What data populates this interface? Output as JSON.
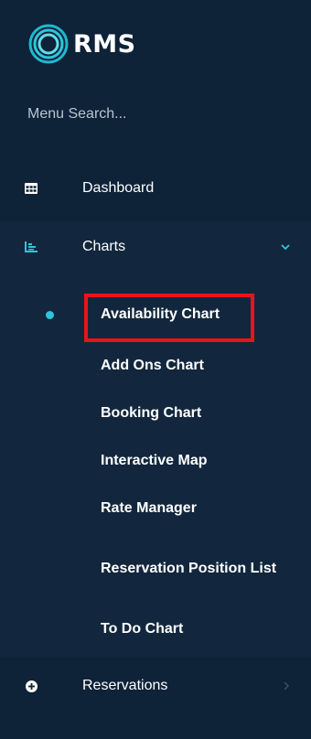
{
  "brand": {
    "name": "RMS"
  },
  "search": {
    "label": "Menu Search..."
  },
  "nav": {
    "dashboard": {
      "label": "Dashboard",
      "icon": "table-grid-icon"
    },
    "charts": {
      "label": "Charts",
      "icon": "bar-chart-icon",
      "expanded": true,
      "items": [
        {
          "label": "Availability Chart",
          "active": true
        },
        {
          "label": "Add Ons Chart"
        },
        {
          "label": "Booking Chart"
        },
        {
          "label": "Interactive Map"
        },
        {
          "label": "Rate Manager"
        },
        {
          "label": "Reservation Position List"
        },
        {
          "label": "To Do Chart"
        }
      ]
    },
    "reservations": {
      "label": "Reservations",
      "icon": "plus-circle-icon"
    }
  },
  "colors": {
    "background": "#0e2238",
    "section_background": "#12273d",
    "accent": "#2ec4dc",
    "highlight": "#e8141c"
  }
}
